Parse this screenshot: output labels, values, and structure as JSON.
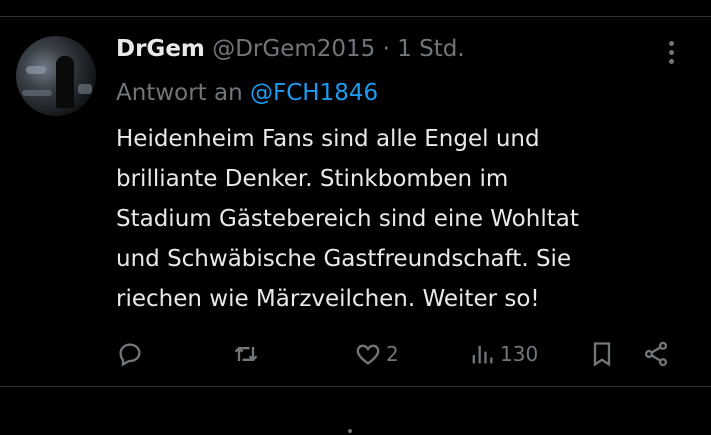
{
  "tweet": {
    "display_name": "DrGem",
    "handle": "@DrGem2015",
    "separator": "·",
    "time": "1 Std.",
    "reply_prefix": "Antwort an",
    "reply_to": "@FCH1846",
    "text_lines": [
      "Heidenheim Fans sind alle Engel und",
      "brilliante Denker. Stinkbomben im",
      "Stadium Gästebereich sind eine Wohltat",
      "und Schwäbische Gastfreundschaft. Sie",
      "riechen wie Märzveilchen. Weiter so!"
    ]
  },
  "actions": {
    "likes": "2",
    "views": "130"
  },
  "colors": {
    "background": "#000000",
    "text": "#e7e9ea",
    "muted": "#71767b",
    "link": "#1d9bf0",
    "divider": "#2f3336"
  },
  "icons": [
    "more-icon",
    "reply-icon",
    "retweet-icon",
    "like-icon",
    "views-icon",
    "bookmark-icon",
    "share-icon"
  ]
}
